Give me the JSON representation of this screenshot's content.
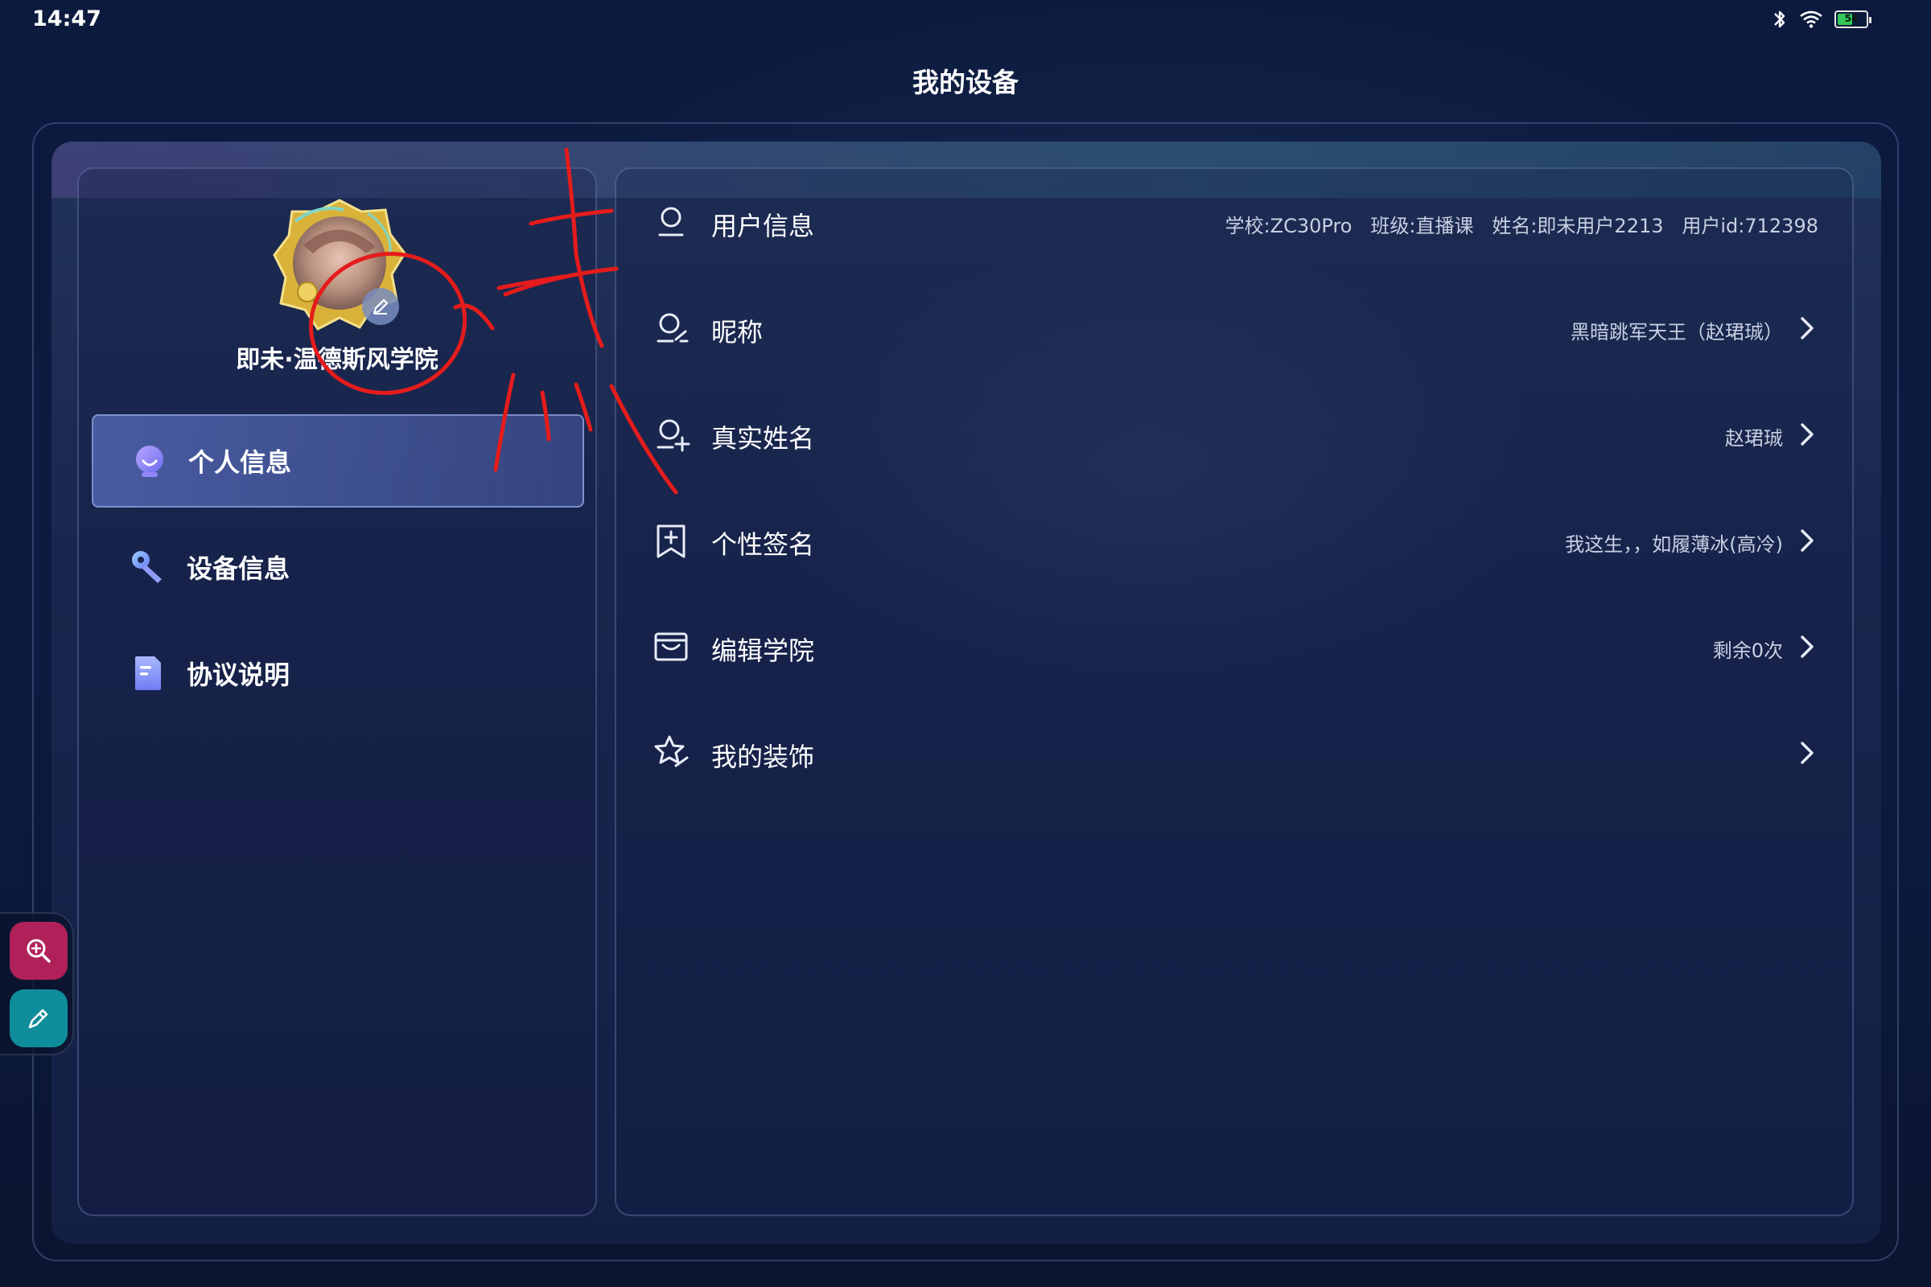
{
  "status_bar": {
    "time": "14:47",
    "icons": [
      "bluetooth-icon",
      "wifi-icon",
      "battery-icon"
    ],
    "battery_level": "54",
    "battery_fraction": 0.54
  },
  "page_title": "我的设备",
  "profile": {
    "academy_name": "即未·温德斯风学院",
    "avatar_icon": "avatar",
    "edit_icon": "pencil-icon"
  },
  "sidebar": {
    "items": [
      {
        "label": "个人信息",
        "icon": "profile-icon",
        "active": true
      },
      {
        "label": "设备信息",
        "icon": "wrench-icon",
        "active": false
      },
      {
        "label": "协议说明",
        "icon": "document-icon",
        "active": false
      }
    ]
  },
  "info_rows": [
    {
      "label": "用户信息",
      "icon": "user-icon",
      "value": "学校:ZC30Pro   班级:直播课   姓名:即未用户2213   用户id:712398",
      "chevron": false
    },
    {
      "label": "昵称",
      "icon": "user-edit-icon",
      "value": "黑暗跳军天王（赵珺珹）",
      "chevron": true
    },
    {
      "label": "真实姓名",
      "icon": "user-add-icon",
      "value": "赵珺珹",
      "chevron": true
    },
    {
      "label": "个性签名",
      "icon": "bookmark-add-icon",
      "value": "我这生，，如履薄冰(高冷)",
      "chevron": true
    },
    {
      "label": "编辑学院",
      "icon": "school-icon",
      "value": "剩余0次",
      "chevron": true
    },
    {
      "label": "我的装饰",
      "icon": "star-hand-icon",
      "value": "",
      "chevron": true
    }
  ],
  "floating_tools": [
    {
      "icon": "zoom-in-icon",
      "color": "#b0215a"
    },
    {
      "icon": "pen-icon",
      "color": "#0f8d9a"
    }
  ],
  "colors": {
    "background": "#0c1b40",
    "panel_gradient_start": "#6e5aaa",
    "panel_gradient_end": "#3c8296",
    "active_item": "#5a6ebe",
    "annotation_red": "#e51c1c"
  },
  "annotation": {
    "type": "handwritten-red-markup",
    "note": "circled edit badge with handwritten 点"
  }
}
